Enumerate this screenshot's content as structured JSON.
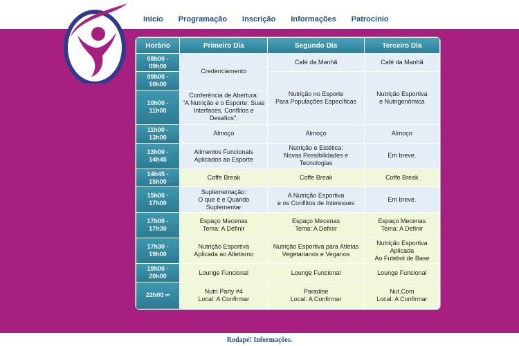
{
  "nav": {
    "items": [
      "Inicio",
      "Programação",
      "Inscrição",
      "Informações",
      "Patrocinio"
    ]
  },
  "schedule": {
    "headers": [
      "Horário",
      "Primeiro Dia",
      "Segundo Dia",
      "Terceiro Dia"
    ],
    "rows": [
      {
        "time": "08h00 - 09h00",
        "d1": "Credenciamento",
        "d2": "Café da Manhã",
        "d3": "Café da Manhã"
      },
      {
        "time": "09h00 - 10h00",
        "d2": "Nutrição no Esporte\nPara Populações Específicas",
        "d3": "Nutrição Esportiva\ne Nutrigenômica"
      },
      {
        "time": "10h00 - 11h00",
        "d1": "Conferência de Abertura:\n\"A Nutrição e o Esporte: Suas Interfaces, Conflitos e Desafios\"."
      },
      {
        "time": "11h00 - 13h00",
        "d1": "Almoço",
        "d2": "Almoço",
        "d3": "Almoço"
      },
      {
        "time": "13h00 - 14h45",
        "d1": "Alimentos Funcionais\nAplicados ao Esporte",
        "d2": "Nutrição e Estética:\nNovas Possibilidades e Tecnologias",
        "d3": "Em breve."
      },
      {
        "time": "14h45 - 15h00",
        "d1": "Coffe Break",
        "d2": "Coffe Break",
        "d3": "Coffe Break"
      },
      {
        "time": "15h00 - 17h00",
        "d1": "Suplementação:\nO que é e Quando Suplementar",
        "d2": "A Nutrição Esportiva\ne os Conflitos de Interesses",
        "d3": "Em breve."
      },
      {
        "time": "17h00 - 17h30",
        "d1": "Espaço Mecenas\nTema: A Definir",
        "d2": "Espaço Mecenas\nTema: A Definir",
        "d3": "Espaço Mecenas\nTema: A Definir"
      },
      {
        "time": "17h30 - 19h00",
        "d1": "Nutrição Esportiva\nAplicada ao Atletismo",
        "d2": "Nutrição Esportiva para Atletas\nVegetarianos e Veganos",
        "d3": "Nutrição Esportiva Aplicada\nAo Futebol de Base"
      },
      {
        "time": "19h00 - 20h00",
        "d1": "Lounge Funcional",
        "d2": "Lounge Funcional",
        "d3": "Lounge Funcional"
      },
      {
        "time": "22h00 ∞",
        "d1": "Nutri Party #4\nLocal: A Confirmar",
        "d2": "Paradise\nLocal: A Confirmar",
        "d3": "Nut.Com\nLocal: A Confirmar"
      }
    ]
  },
  "colors": {
    "band": "#a8207f",
    "cell_blue": "#e5eef6",
    "cell_green": "#f1f7d9",
    "header_teal": "#2d7f98",
    "nav_text": "#1f4f8f"
  },
  "footer": {
    "text": "Rodapé! Informações."
  }
}
